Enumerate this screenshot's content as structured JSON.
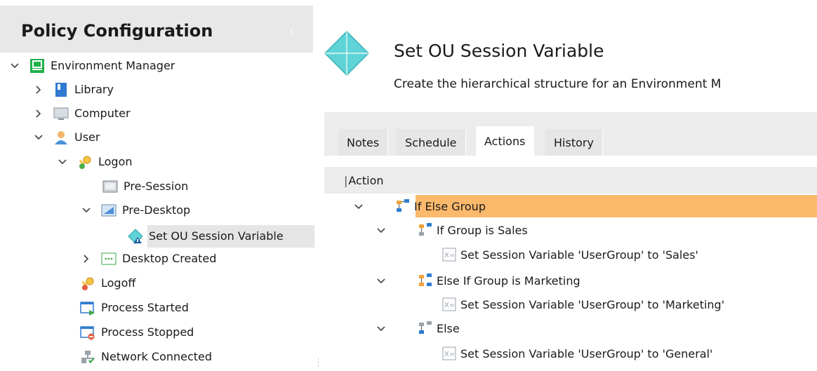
{
  "left_panel": {
    "title": "Policy Configuration",
    "tree": [
      {
        "key": "environment_manager",
        "label": "Environment Manager",
        "icon": "environment-manager-icon",
        "expanded": true
      },
      {
        "key": "library",
        "label": "Library",
        "icon": "library-book-icon",
        "expanded": false
      },
      {
        "key": "computer",
        "label": "Computer",
        "icon": "computer-monitor-icon",
        "expanded": false
      },
      {
        "key": "user",
        "label": "User",
        "icon": "user-person-icon",
        "expanded": true
      },
      {
        "key": "logon",
        "label": "Logon",
        "icon": "logon-key-icon",
        "expanded": true
      },
      {
        "key": "pre_session",
        "label": "Pre-Session",
        "icon": "pre-session-icon"
      },
      {
        "key": "pre_desktop",
        "label": "Pre-Desktop",
        "icon": "pre-desktop-icon",
        "expanded": true
      },
      {
        "key": "set_ou",
        "label": "Set OU Session Variable",
        "icon": "reusable-node-icon",
        "selected": true
      },
      {
        "key": "desktop_created",
        "label": "Desktop Created",
        "icon": "desktop-created-icon",
        "expanded": false
      },
      {
        "key": "logoff",
        "label": "Logoff",
        "icon": "logoff-key-icon"
      },
      {
        "key": "process_started",
        "label": "Process Started",
        "icon": "process-started-icon"
      },
      {
        "key": "process_stopped",
        "label": "Process Stopped",
        "icon": "process-stopped-icon"
      },
      {
        "key": "network_connected",
        "label": "Network Connected",
        "icon": "network-connected-icon"
      }
    ]
  },
  "right_panel": {
    "title": "Set OU Session Variable",
    "description": "Create the hierarchical structure for an Environment M",
    "tabs": [
      "Notes",
      "Schedule",
      "Actions",
      "History"
    ],
    "active_tab": "Actions",
    "column_header": "Action",
    "actions": [
      {
        "label": "If Else Group",
        "icon": "if-else-group-icon",
        "highlighted": true
      },
      {
        "label": "If Group is Sales",
        "icon": "condition-group-icon"
      },
      {
        "label": "Set Session Variable 'UserGroup' to 'Sales'",
        "icon": "set-variable-icon"
      },
      {
        "label": "Else If Group is Marketing",
        "icon": "else-if-group-icon"
      },
      {
        "label": "Set Session Variable 'UserGroup' to 'Marketing'",
        "icon": "set-variable-icon"
      },
      {
        "label": "Else",
        "icon": "else-group-icon"
      },
      {
        "label": "Set Session Variable 'UserGroup' to 'General'",
        "icon": "set-variable-icon"
      }
    ]
  },
  "colors": {
    "header_bg": "#e8e8e8",
    "highlight": "#fbb96c",
    "selection": "#e5e5e5",
    "diamond": "#5fd3d6"
  }
}
